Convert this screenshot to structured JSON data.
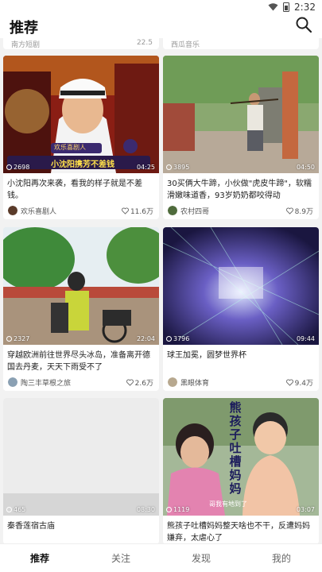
{
  "status_bar": {
    "time": "2:32"
  },
  "header": {
    "title": "推荐"
  },
  "top_strip": [
    {
      "author": "南方短剧",
      "likes": "22.5"
    },
    {
      "author": "西瓜音乐",
      "likes": ""
    }
  ],
  "cards": [
    {
      "title": "小沈阳再次来袭，看我的样子就是不差钱。",
      "plays": "2698",
      "duration": "04:25",
      "author": "欢乐喜剧人",
      "likes": "11.6万",
      "overlay_tag": "欢乐喜剧人",
      "overlay_caption": "小沈阳携芳不差钱"
    },
    {
      "title": "30买俩大牛蹄，小伙做\"虎皮牛蹄\"，软糯滑嫩味道香，93岁奶奶都咬得动",
      "plays": "3895",
      "duration": "04:50",
      "author": "农村四哥",
      "likes": "8.9万"
    },
    {
      "title": "穿越欧洲前往世界尽头冰岛，准备离开德国去丹麦，天天下雨受不了",
      "plays": "2327",
      "duration": "22:04",
      "author": "陶三丰草根之旅",
      "likes": "2.6万"
    },
    {
      "title": "球王加冕，圆梦世界杯",
      "plays": "3796",
      "duration": "09:44",
      "author": "黑眼体育",
      "likes": "9.4万"
    },
    {
      "title": "秦香莲宿古庙",
      "plays": "465",
      "duration": "08:30",
      "author": "",
      "likes": ""
    },
    {
      "title": "熊孩子吐槽妈妈整天啥也不干，反遭妈妈嫌弃，太虐心了",
      "plays": "1119",
      "duration": "03:07",
      "author": "",
      "likes": "",
      "overlay_caption": "熊孩子吐槽妈妈",
      "overlay_subtitle": "哥我有地到了"
    }
  ],
  "tabs": [
    {
      "label": "推荐",
      "active": true
    },
    {
      "label": "关注",
      "active": false
    },
    {
      "label": "发现",
      "active": false
    },
    {
      "label": "我的",
      "active": false
    }
  ],
  "colors": {
    "accent": "#111111",
    "muted": "#666666",
    "background": "#f2f2f2"
  }
}
